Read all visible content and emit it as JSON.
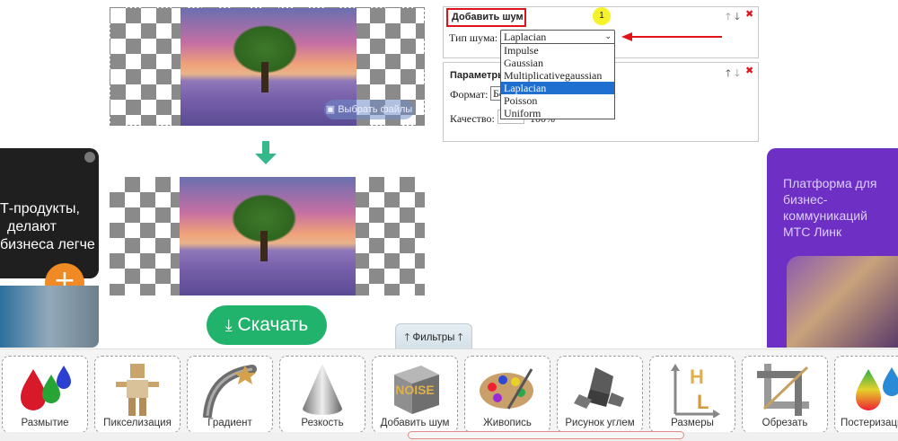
{
  "upload_button_label": "Выбрать файлы",
  "download_button_label": "Скачать",
  "noise_panel": {
    "title": "Добавить шум",
    "noise_type_label": "Тип шума:",
    "selected": "Laplacian",
    "options": [
      "Impulse",
      "Gaussian",
      "Multiplicativegaussian",
      "Laplacian",
      "Poisson",
      "Uniform"
    ],
    "annotation_badge": "1"
  },
  "params_panel": {
    "title": "Параметры",
    "format_label": "Формат:",
    "format_value": "Бе",
    "quality_label": "Качество:",
    "quality_value": "100%"
  },
  "ads": {
    "left_lines": [
      "Т-продукты,",
      "делают",
      "бизнеса легче"
    ],
    "right_lines": [
      "Платформа для",
      "бизнес-",
      "коммуникаций",
      "МТС Линк"
    ]
  },
  "filters_tab_label": "Фильтры",
  "tools": [
    {
      "label": "Размытие",
      "icon": "drops-icon"
    },
    {
      "label": "Пикселизация",
      "icon": "pixel-figure-icon"
    },
    {
      "label": "Градиент",
      "icon": "gradient-arc-icon"
    },
    {
      "label": "Резкость",
      "icon": "cone-icon"
    },
    {
      "label": "Добавить шум",
      "icon": "noise-cube-icon"
    },
    {
      "label": "Живопись",
      "icon": "palette-icon"
    },
    {
      "label": "Рисунок углем",
      "icon": "charcoal-icon"
    },
    {
      "label": "Размеры",
      "icon": "resize-hl-icon"
    },
    {
      "label": "Обрезать",
      "icon": "crop-icon"
    },
    {
      "label": "Постеризация",
      "icon": "posterize-drops-icon"
    }
  ],
  "colors": {
    "accent_green": "#21b36b",
    "highlight_blue": "#1e6fd0",
    "annotation_red": "#e0121a",
    "badge_yellow": "#f5f229"
  }
}
